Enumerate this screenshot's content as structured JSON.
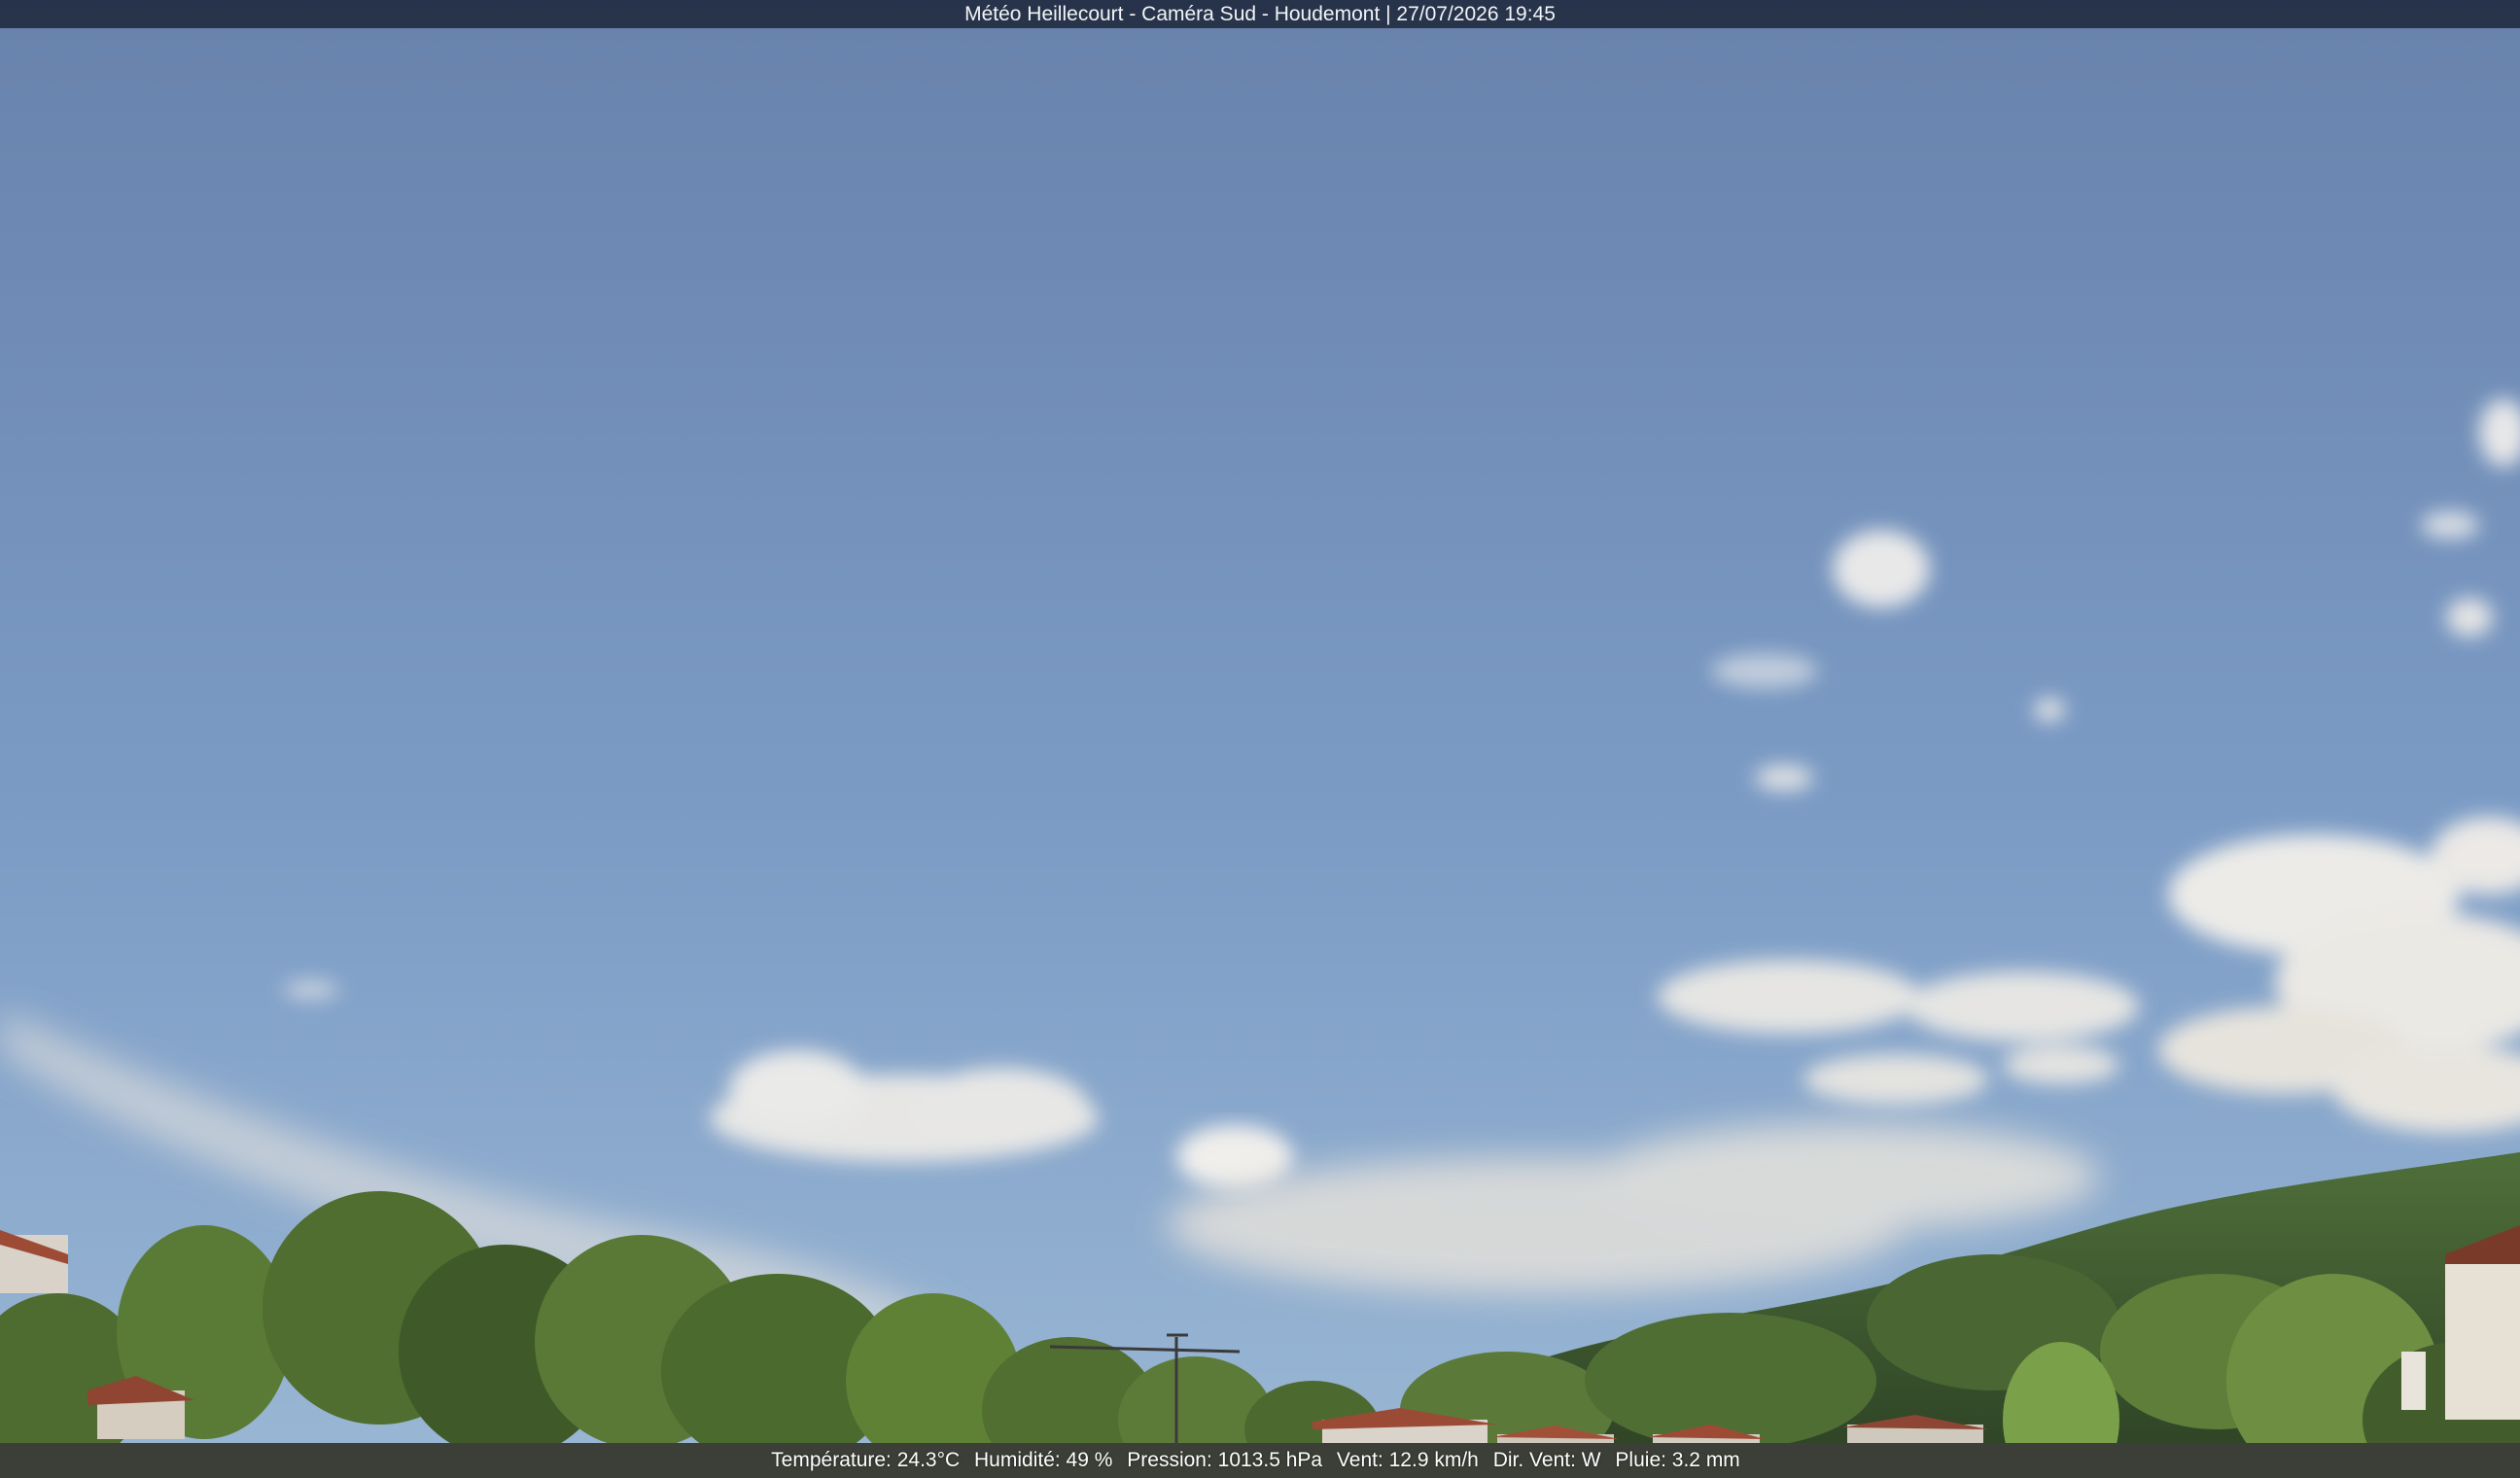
{
  "overlay": {
    "title": "Météo Heillecourt - Caméra Sud - Houdemont | 27/07/2026 19:45"
  },
  "weather": {
    "temperature": "Température: 24.3°C",
    "humidity": "Humidité: 49 %",
    "pressure": "Pression: 1013.5 hPa",
    "wind_speed": "Vent: 12.9 km/h",
    "wind_direction": "Dir. Vent: W",
    "rain": "Pluie: 3.2 mm"
  },
  "colors": {
    "sky_top": "#6882ac",
    "sky_bottom": "#93b1d1",
    "cloud": "#f0ede8",
    "foliage": "#5f7f3e",
    "roof": "#9e4b36"
  }
}
